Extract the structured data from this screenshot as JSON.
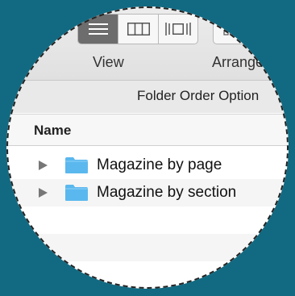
{
  "toolbar": {
    "view_label": "View",
    "arrange_label": "Arrange",
    "view_modes": [
      {
        "name": "list",
        "icon": "list-view-icon",
        "selected": true
      },
      {
        "name": "columns",
        "icon": "column-view-icon",
        "selected": false
      },
      {
        "name": "cover-flow",
        "icon": "cover-flow-icon",
        "selected": false
      }
    ],
    "arrange_icon": "arrange-grid-icon"
  },
  "folder_order_options": "Folder Order Option",
  "list": {
    "column_header": "Name",
    "items": [
      {
        "label": "Magazine by page",
        "icon": "folder-icon",
        "expanded": false
      },
      {
        "label": "Magazine by section",
        "icon": "folder-icon",
        "expanded": false
      }
    ]
  },
  "colors": {
    "background": "#116a82",
    "folder": "#5ab8ee",
    "selected_segment": "#6d6d6d"
  }
}
